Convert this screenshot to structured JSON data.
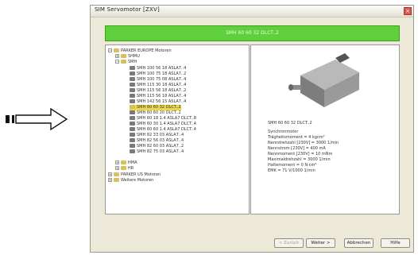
{
  "window": {
    "title": "SIM Servomotor [ZXV]",
    "close_label": "×"
  },
  "banner": {
    "text": "SMH 60 60 32 DLCT..2"
  },
  "tree": {
    "root1": "PARKER EUROPE Motoren",
    "group1": "SHMU",
    "group2": "SMH",
    "items": [
      "SMH 100 56 18 ASLA7..4",
      "SMH 100 75 18 ASLA7..2",
      "SMH 100 75 08 ASLA7..4",
      "SMH 115 30 18 ASLA7..4",
      "SMH 115 56 18 ASLA7..2",
      "SMH 115 56 18 ASLA7..4",
      "SMH 142 56 15 ASLA7..4",
      "SMH 60 60 32 DLCT..2",
      "SMH 60 60 20 DLCT..2",
      "SMH 60 18 1.4 ASLA7 DLCT..8",
      "SMH 60 30 1.4 ASLA7 DLCT..4",
      "SMH 60 60 1.4 ASLA7 DLCT..4",
      "SMH 82 33 03 ASLA7..4",
      "SMH 82 56 03 ASLA7..4",
      "SMH 82 60 03 ASLA7..2",
      "SMH 82 75 03 ASLA7..4"
    ],
    "selected_index": 7,
    "group3": "HMA",
    "group4": "HR",
    "root2": "PARKER US Motoren",
    "root3": "Weitere Motoren"
  },
  "details": {
    "name": "SMH 60 60 32 DLCT..2",
    "specs": [
      "Synchronmotor",
      "Trägheitsmoment = 4 kgcm²",
      "Nenndrehzahl [230V] = 3000 1/min",
      "Nennstrom [230V] = 400 mA",
      "Nennmoment [230V] = 10 mNm",
      "Maximaldrehzahl = 3000 1/min",
      "Haltemoment = 0 N·cm²",
      "EMK = 71 V/1000 1/min"
    ]
  },
  "buttons": {
    "back": "< Zurück",
    "next": "Weiter >",
    "cancel": "Abbrechen",
    "help": "Hilfe"
  },
  "colors": {
    "banner": "#5fcf3c",
    "selection": "#e8d84a",
    "window_bg": "#ece9d8"
  }
}
